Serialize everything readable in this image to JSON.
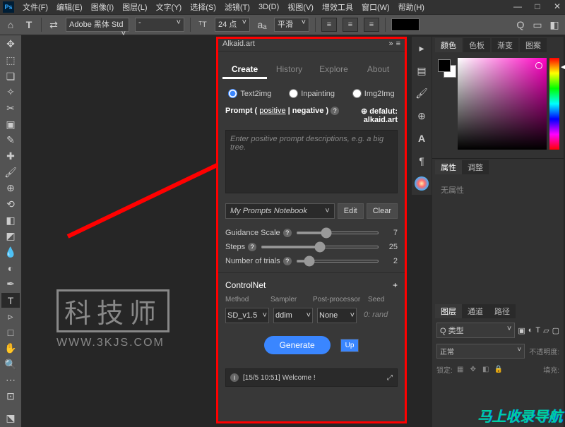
{
  "menubar": {
    "items": [
      "文件(F)",
      "编辑(E)",
      "图像(I)",
      "图层(L)",
      "文字(Y)",
      "选择(S)",
      "滤镜(T)",
      "3D(D)",
      "视图(V)",
      "增效工具",
      "窗口(W)",
      "帮助(H)"
    ]
  },
  "toolbar": {
    "home_icon": "⌂",
    "tool_icon": "T",
    "toggle_icon": "⇄",
    "font_select": "Adobe 黑体 Std",
    "style_select": "-",
    "size_icon": "T",
    "size_value": "24 点",
    "aa_icon": "aₐ",
    "aa_select": "平滑",
    "right_icons": [
      "▦",
      "▭",
      "◧"
    ]
  },
  "plugin": {
    "title": "Alkaid.art",
    "tabs": [
      "Create",
      "History",
      "Explore",
      "About"
    ],
    "active_tab": 0,
    "modes": [
      "Text2img",
      "Inpainting",
      "Img2Img"
    ],
    "mode_selected": 0,
    "prompt_label_pre": "Prompt ( ",
    "prompt_label_pos": "positive",
    "prompt_label_sep": " | negative )",
    "default_label_pre": "⊕ defalut:",
    "default_label_val": "alkaid.art",
    "prompt_placeholder": "Enter positive prompt descriptions, e.g. a big tree.",
    "notebook": "My Prompts Notebook",
    "edit_btn": "Edit",
    "clear_btn": "Clear",
    "guidance_label": "Guidance Scale",
    "guidance_val": "7",
    "steps_label": "Steps",
    "steps_val": "25",
    "trials_label": "Number of trials",
    "trials_val": "2",
    "controlnet": "ControlNet",
    "controlnet_plus": "+",
    "cn_headers": [
      "Method",
      "Sampler",
      "Post-processor",
      "Seed"
    ],
    "cn_method": "SD_v1.5",
    "cn_sampler": "ddim",
    "cn_post": "None",
    "cn_seed_ph": "0: rand",
    "generate": "Generate",
    "up": "Up",
    "log": "[15/5 10:51] Welcome !"
  },
  "right": {
    "color_tabs": [
      "颜色",
      "色板",
      "渐变",
      "图案"
    ],
    "prop_tabs": [
      "属性",
      "调整"
    ],
    "prop_body": "无属性",
    "layer_tabs": [
      "图层",
      "通道",
      "路径"
    ],
    "kind_label": "Q 类型",
    "blend": "正常",
    "opacity_label": "不透明度:",
    "lock_label": "锁定:",
    "fill_label": "填充:"
  },
  "watermark": {
    "cn": "科技师",
    "url": "WWW.3KJS.COM"
  },
  "promo": "马上收录导航"
}
